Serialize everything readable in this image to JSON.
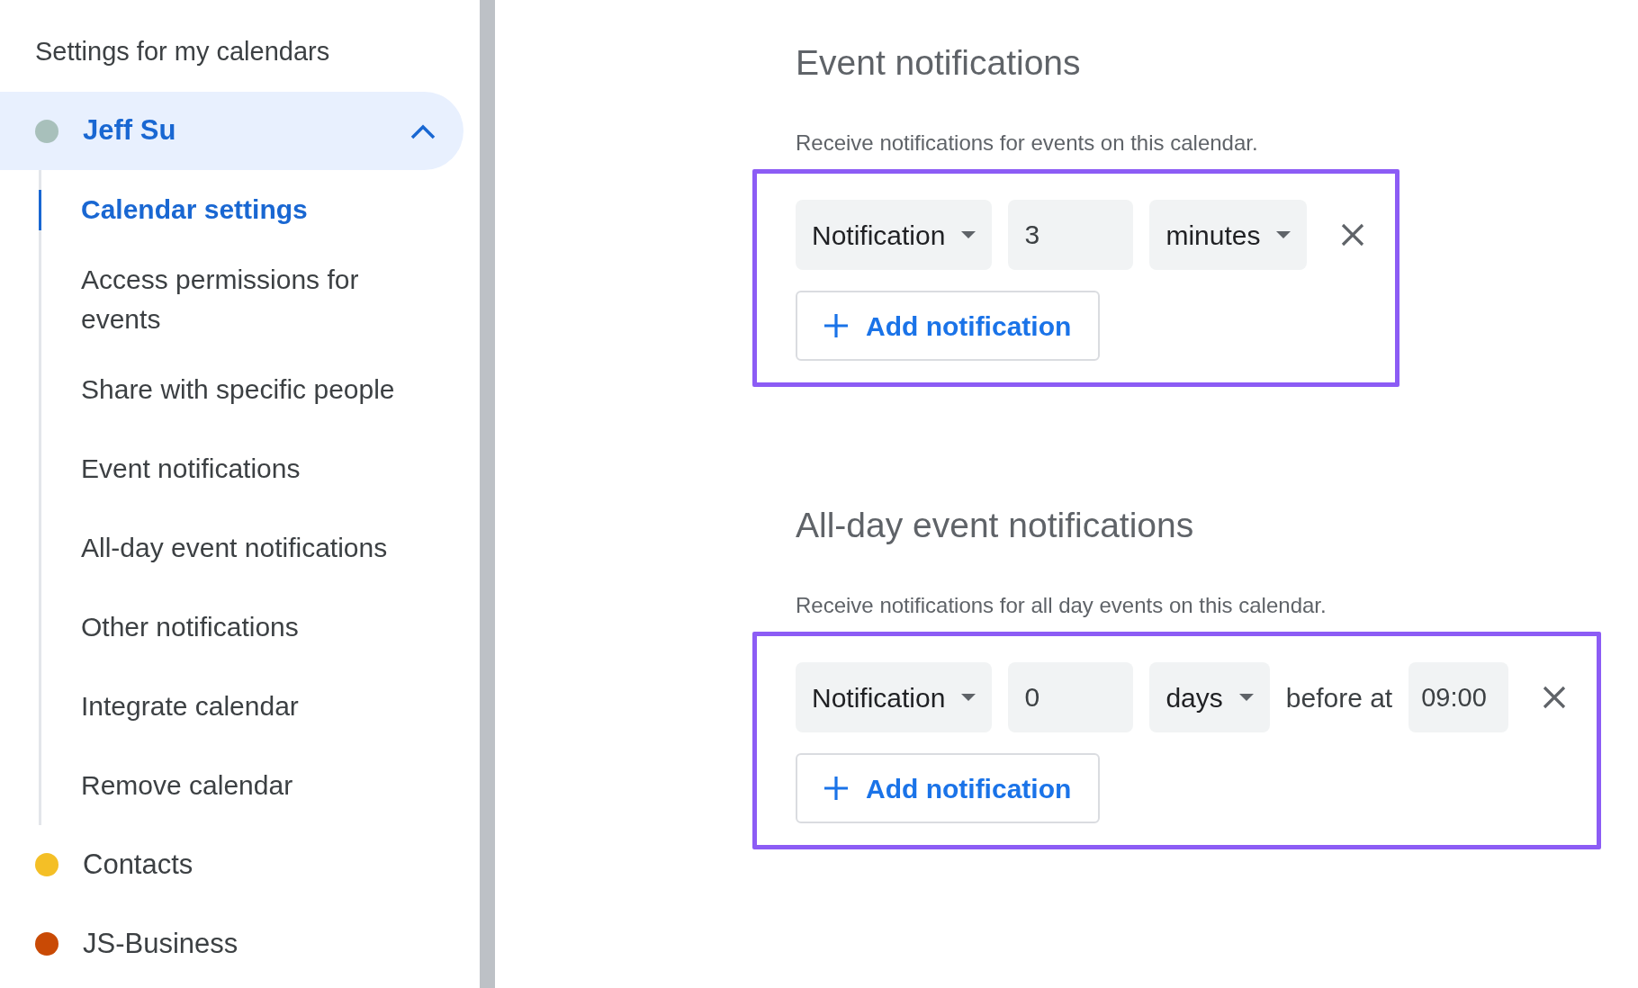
{
  "sidebar": {
    "title": "Settings for my calendars",
    "calendars": [
      {
        "name": "Jeff Su",
        "color": "#a8c0bb",
        "selected": true,
        "expanded": true,
        "children": [
          {
            "label": "Calendar settings",
            "selected": true
          },
          {
            "label": "Access permissions for events",
            "selected": false
          },
          {
            "label": "Share with specific people",
            "selected": false
          },
          {
            "label": "Event notifications",
            "selected": false
          },
          {
            "label": "All-day event notifications",
            "selected": false
          },
          {
            "label": "Other notifications",
            "selected": false
          },
          {
            "label": "Integrate calendar",
            "selected": false
          },
          {
            "label": "Remove calendar",
            "selected": false
          }
        ]
      },
      {
        "name": "Contacts",
        "color": "#f4bf26",
        "selected": false,
        "expanded": false
      },
      {
        "name": "JS-Business",
        "color": "#c94a05",
        "selected": false,
        "expanded": false
      }
    ]
  },
  "sections": [
    {
      "title": "Event notifications",
      "description": "Receive notifications for events on this calendar.",
      "highlighted": true,
      "notifications": [
        {
          "method": "Notification",
          "amount": "3",
          "unit": "minutes"
        }
      ],
      "add_button": "Add notification"
    },
    {
      "title": "All-day event notifications",
      "description": "Receive notifications for all day events on this calendar.",
      "highlighted": true,
      "notifications": [
        {
          "method": "Notification",
          "amount": "0",
          "unit": "days",
          "time_label": "before at",
          "time": "09:00"
        }
      ],
      "add_button": "Add notification"
    }
  ]
}
